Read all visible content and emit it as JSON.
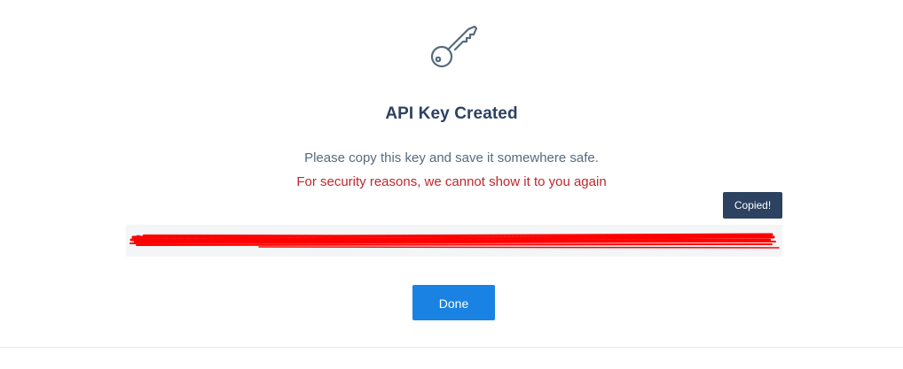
{
  "dialog": {
    "icon": "key-icon",
    "title": "API Key Created",
    "message": "Please copy this key and save it somewhere safe.",
    "warning": "For security reasons, we cannot show it to you again",
    "tooltip": "Copied!",
    "done_label": "Done"
  },
  "colors": {
    "title": "#2c4260",
    "warning": "#c0272d",
    "button": "#1a82e2",
    "tooltip_bg": "#2c4260",
    "redaction": "#ff0000"
  }
}
